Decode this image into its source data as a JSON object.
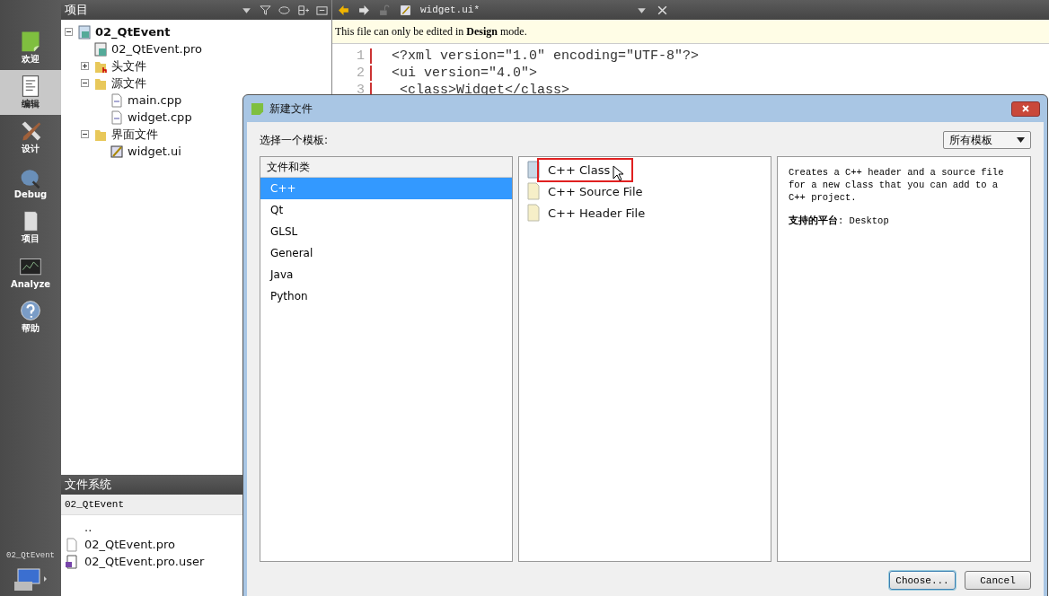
{
  "mode_bar": {
    "items": [
      {
        "kind": "welcome",
        "label": "欢迎",
        "selected": false
      },
      {
        "kind": "edit",
        "label": "编辑",
        "selected": true
      },
      {
        "kind": "design",
        "label": "设计",
        "selected": false
      },
      {
        "kind": "debug",
        "label": "Debug",
        "selected": false
      },
      {
        "kind": "projects",
        "label": "项目",
        "selected": false
      },
      {
        "kind": "analyze",
        "label": "Analyze",
        "selected": false
      },
      {
        "kind": "help",
        "label": "帮助",
        "selected": false
      }
    ],
    "project_label": "02_QtEvent"
  },
  "projects_pane": {
    "title": "项目",
    "tree": [
      {
        "kind": "project",
        "label": "02_QtEvent",
        "expanded": true,
        "children": [
          {
            "kind": "pro",
            "label": "02_QtEvent.pro"
          },
          {
            "kind": "headers",
            "label": "头文件",
            "expanded": false
          },
          {
            "kind": "sources",
            "label": "源文件",
            "expanded": true,
            "children": [
              {
                "kind": "cpp",
                "label": "main.cpp"
              },
              {
                "kind": "cpp",
                "label": "widget.cpp"
              }
            ]
          },
          {
            "kind": "forms",
            "label": "界面文件",
            "expanded": true,
            "children": [
              {
                "kind": "ui",
                "label": "widget.ui"
              }
            ]
          }
        ]
      }
    ]
  },
  "file_system": {
    "title": "文件系统",
    "path": "02_QtEvent",
    "items": [
      {
        "kind": "up",
        "label": ".."
      },
      {
        "kind": "pro",
        "label": "02_QtEvent.pro"
      },
      {
        "kind": "user",
        "label": "02_QtEvent.pro.user"
      }
    ]
  },
  "editor": {
    "file": "widget.ui*",
    "info": "This file can only be edited in **Design** mode.",
    "lines": [
      {
        "number": "1",
        "text": "<?xml version=\"1.0\" encoding=\"UTF-8\"?>"
      },
      {
        "number": "2",
        "text": "<ui version=\"4.0\">"
      },
      {
        "number": "3",
        "text": " <class>Widget</class>"
      }
    ]
  },
  "dialog": {
    "title": "新建文件",
    "prompt": "选择一个模板:",
    "filter": "所有模板",
    "categories_header": "文件和类",
    "categories": [
      {
        "label": "C++",
        "selected": true
      },
      {
        "label": "Qt",
        "selected": false
      },
      {
        "label": "GLSL",
        "selected": false
      },
      {
        "label": "General",
        "selected": false
      },
      {
        "label": "Java",
        "selected": false
      },
      {
        "label": "Python",
        "selected": false
      }
    ],
    "templates": [
      {
        "kind": "class",
        "label": "C++ Class",
        "highlighted": true
      },
      {
        "kind": "file",
        "label": "C++ Source File",
        "highlighted": false
      },
      {
        "kind": "file",
        "label": "C++ Header File",
        "highlighted": false
      }
    ],
    "description": "Creates a C++ header and a source file for a new class that you can add to a C++ project.",
    "platforms": "**支持的平台**: Desktop",
    "buttons": [
      {
        "label": "Choose...",
        "default": true
      },
      {
        "label": "Cancel",
        "default": false
      }
    ]
  }
}
